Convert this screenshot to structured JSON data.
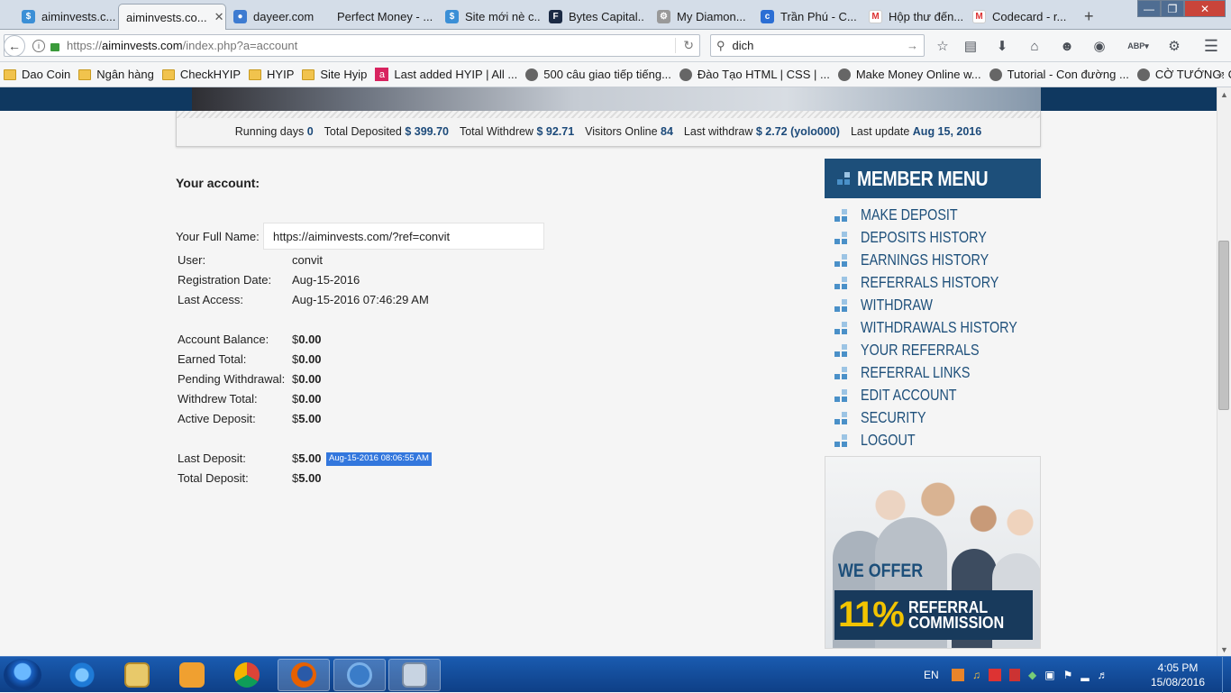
{
  "browser": {
    "tabs": [
      {
        "label": "aiminvests.c...",
        "active": false,
        "icon": "globe-icon"
      },
      {
        "label": "aiminvests.co...",
        "active": true,
        "icon": ""
      },
      {
        "label": "dayeer.com",
        "active": false,
        "icon": "drop-icon"
      },
      {
        "label": "Perfect Money - ...",
        "active": false,
        "icon": ""
      },
      {
        "label": "Site mới nè c...",
        "active": false,
        "icon": "globe-icon"
      },
      {
        "label": "Bytes Capital...",
        "active": false,
        "icon": "f-icon"
      },
      {
        "label": "My Diamon...",
        "active": false,
        "icon": "gear-icon"
      },
      {
        "label": "Trần Phú - C...",
        "active": false,
        "icon": "c-icon"
      },
      {
        "label": "Hộp thư đến...",
        "active": false,
        "icon": "gmail-icon"
      },
      {
        "label": "Codecard - r...",
        "active": false,
        "icon": "gmail-icon"
      }
    ],
    "new_tab": "+",
    "url": "https://aiminvests.com/index.php?a=account",
    "url_host": "aiminvests.com",
    "url_prefix": "https://",
    "url_path": "/index.php?a=account",
    "search_value": "dich",
    "bookmarks": [
      {
        "label": "Dao Coin",
        "icon": "folder"
      },
      {
        "label": "Ngân hàng",
        "icon": "folder"
      },
      {
        "label": "CheckHYIP",
        "icon": "folder"
      },
      {
        "label": "HYIP",
        "icon": "folder"
      },
      {
        "label": "Site Hyip",
        "icon": "folder"
      },
      {
        "label": "Last added HYIP | All ...",
        "icon": "a-icon"
      },
      {
        "label": "500 câu giao tiếp tiếng...",
        "icon": "globe"
      },
      {
        "label": "Đào Tạo HTML | CSS | ...",
        "icon": "globe"
      },
      {
        "label": "Make Money Online w...",
        "icon": "globe"
      },
      {
        "label": "Tutorial - Con đường ...",
        "icon": "globe"
      },
      {
        "label": "CỜ TƯỚNG: CHUYÊN ...",
        "icon": "globe"
      }
    ]
  },
  "stats": {
    "running_days_label": "Running days",
    "running_days": "0",
    "total_deposited_label": "Total Deposited",
    "total_deposited": "$ 399.70",
    "total_withdrew_label": "Total Withdrew",
    "total_withdrew": "$ 92.71",
    "visitors_label": "Visitors Online",
    "visitors": "84",
    "last_withdraw_label": "Last withdraw",
    "last_withdraw": "$ 2.72 (yolo000)",
    "last_update_label": "Last update",
    "last_update": "Aug 15, 2016"
  },
  "account": {
    "title": "Your account:",
    "full_name_label": "Your Full Name:",
    "full_name_value": "https://aiminvests.com/?ref=convit",
    "rows": [
      {
        "label": "User:",
        "value": "convit"
      },
      {
        "label": "Registration Date:",
        "value": "Aug-15-2016"
      },
      {
        "label": "Last Access:",
        "value": "Aug-15-2016 07:46:29 AM"
      }
    ],
    "balances": [
      {
        "label": "Account Balance:",
        "currency": "$",
        "amount": "0.00"
      },
      {
        "label": "Earned Total:",
        "currency": "$",
        "amount": "0.00"
      },
      {
        "label": "Pending Withdrawal:",
        "currency": "$",
        "amount": "0.00"
      },
      {
        "label": "Withdrew Total:",
        "currency": "$",
        "amount": "0.00"
      },
      {
        "label": "Active Deposit:",
        "currency": "$",
        "amount": "5.00"
      }
    ],
    "last_deposit_label": "Last Deposit:",
    "last_deposit_currency": "$",
    "last_deposit_amount": "5.00",
    "last_deposit_date": "Aug-15-2016 08:06:55 AM",
    "total_deposit_label": "Total Deposit:",
    "total_deposit_currency": "$",
    "total_deposit_amount": "5.00"
  },
  "member_menu": {
    "title": "MEMBER MENU",
    "items": [
      "MAKE DEPOSIT",
      "DEPOSITS HISTORY",
      "EARNINGS HISTORY",
      "REFERRALS HISTORY",
      "WITHDRAW",
      "WITHDRAWALS HISTORY",
      "YOUR REFERRALS",
      "REFERRAL LINKS",
      "EDIT ACCOUNT",
      "SECURITY",
      "LOGOUT"
    ]
  },
  "banner": {
    "we_offer": "WE OFFER",
    "percent": "11%",
    "line1": "REFERRAL",
    "line2": "COMMISSION"
  },
  "taskbar": {
    "lang": "EN",
    "time": "4:05 PM",
    "date": "15/08/2016"
  }
}
